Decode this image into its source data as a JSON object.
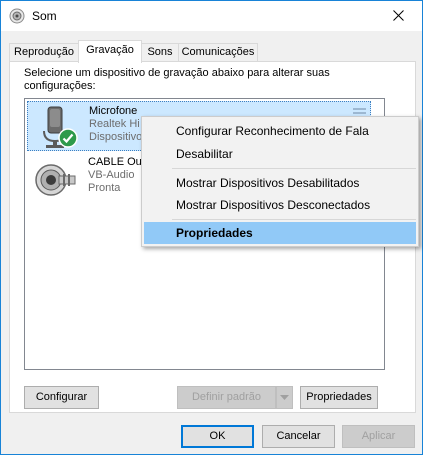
{
  "window": {
    "title": "Som"
  },
  "tabs": [
    {
      "label": "Reprodução",
      "active": false
    },
    {
      "label": "Gravação",
      "active": true
    },
    {
      "label": "Sons",
      "active": false
    },
    {
      "label": "Comunicações",
      "active": false
    }
  ],
  "instruction_line1": "Selecione um dispositivo de gravação abaixo para alterar suas",
  "instruction_line2": "configurações:",
  "devices": [
    {
      "name": "Microfone",
      "line2": "Realtek Hi",
      "line3": "Dispositivo",
      "selected": true,
      "icon": "microphone-icon",
      "status": "check-badge-icon"
    },
    {
      "name": "CABLE Out",
      "line2": "VB-Audio ",
      "line3": "Pronta",
      "selected": false,
      "icon": "cable-plug-icon"
    }
  ],
  "context_menu": [
    {
      "label": "Configurar Reconhecimento de Fala"
    },
    {
      "label": "Desabilitar"
    },
    {
      "label": "Mostrar Dispositivos Desabilitados"
    },
    {
      "label": "Mostrar Dispositivos Desconectados"
    },
    {
      "label": "Propriedades",
      "highlighted": true
    }
  ],
  "panel_buttons": {
    "configure": "Configurar",
    "set_default": "Definir padrão",
    "properties": "Propriedades"
  },
  "dialog_buttons": {
    "ok": "OK",
    "cancel": "Cancelar",
    "apply": "Aplicar"
  },
  "colors": {
    "selection": "#cce8ff",
    "menu_highlight": "#91c9f7",
    "accent": "#0078d7"
  }
}
